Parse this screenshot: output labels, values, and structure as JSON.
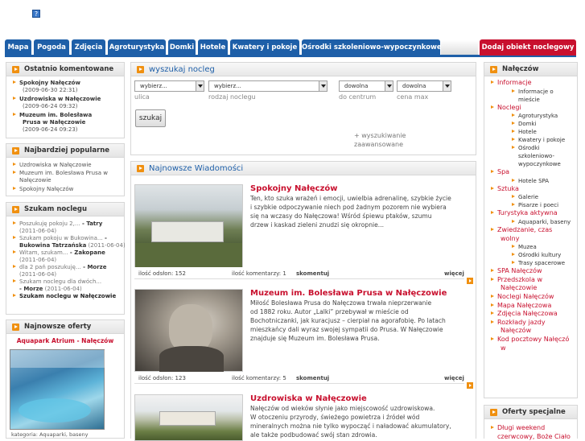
{
  "nav": {
    "tabs": [
      "Mapa",
      "Pogoda",
      "Zdjęcia",
      "Agroturystyka",
      "Domki",
      "Hotele",
      "Kwatery i pokoje",
      "Ośrodki szkoleniowo-wypoczynkowe"
    ],
    "add_button": "Dodaj obiekt noclegowy"
  },
  "left": {
    "recent": {
      "title": "Ostatnio komentowane",
      "items": [
        {
          "name": "Spokojny Nałęczów",
          "date": "(2009-06-30 22:31)"
        },
        {
          "name": "Uzdrowiska w Nałęczowie",
          "date": "(2009-06-24 09:32)"
        },
        {
          "name": "Muzeum im. Bolesława",
          "name2": "Prusa w Nałęczowie",
          "date": "(2009-06-24 09:23)"
        }
      ]
    },
    "popular": {
      "title": "Najbardziej popularne",
      "items": [
        "Uzdrowiska w Nałęczowie",
        "Muzeum im. Bolesława Prusa w",
        "Nałęczowie",
        "Spokojny Nałęczów"
      ]
    },
    "search": {
      "title": "Szukam noclegu",
      "lines": [
        {
          "a": "Poszukuję pokoju 2,...",
          "b": " - Tatry"
        },
        {
          "a": "(2011-06-04)",
          "b": ""
        },
        {
          "a": "Szukam pokoju w Bukowina...",
          "b": " -"
        },
        {
          "a": "Bukowina Tatrzańska",
          "b": " (2011-06-04)"
        },
        {
          "a": "Witam, szukam...",
          "b": " - Zakopane"
        },
        {
          "a": "(2011-06-04)",
          "b": ""
        },
        {
          "a": "dla 2 pań poszukuję...",
          "b": " - Morze"
        },
        {
          "a": "(2011-06-04)",
          "b": ""
        },
        {
          "a": "Szukam noclegu dla dwóch...",
          "b": ""
        },
        {
          "a": "- Morze",
          "b": " (2011-06-04)"
        }
      ],
      "footer": "Szukam noclegu w Nałęczowie"
    },
    "offers": {
      "title": "Najnowsze oferty",
      "offer_title": "Aquapark Atrium - Nałęczów",
      "category": "kategoria: Aquaparki, baseny"
    }
  },
  "search_panel": {
    "title": "wyszukaj nocleg",
    "selects": [
      {
        "value": "wybierz...",
        "label": "ulica"
      },
      {
        "value": "wybierz...",
        "label": "rodzaj noclegu"
      },
      {
        "value": "dowolna",
        "label": "do centrum"
      },
      {
        "value": "dowolna",
        "label": "cena max"
      }
    ],
    "button": "szukaj",
    "advanced": "+ wyszukiwanie zaawansowane"
  },
  "news": {
    "title": "Najnowsze Wiadomości",
    "items": [
      {
        "title": "Spokojny Nałęczów",
        "lines": [
          "Ten, kto szuka wrażeń i emocji, uwielbia adrenalinę, szybkie życie",
          "i szybkie odpoczywanie niech pod żadnym pozorem nie wybiera",
          "się na wczasy do Nałęczowa! Wśród śpiewu ptaków, szumu",
          "drzew i kaskad zieleni znudzi się okropnie..."
        ],
        "views": "ilość odsłon: 152",
        "comments": "ilość komentarzy: 1",
        "comments_link": "skomentuj",
        "more": "więcej"
      },
      {
        "title": "Muzeum im. Bolesława Prusa w Nałęczowie",
        "lines": [
          "Miłość Bolesława Prusa do Nałęczowa trwała nieprzerwanie",
          "od 1882 roku. Autor „Lalki” przebywał w mieście od",
          "Bochotniczanki, jak kuracjusz – cierpiał na agorafobię. Po latach",
          "mieszkańcy dali wyraz swojej sympatii do Prusa. W Nałęczowie",
          "znajduje się Muzeum im. Bolesława Prusa."
        ],
        "views": "ilość odsłon: 123",
        "comments": "ilość komentarzy: 5",
        "comments_link": "skomentuj",
        "more": "więcej"
      },
      {
        "title": "Uzdrowiska w Nałęczowie",
        "lines": [
          "Nałęczów od wieków słynie jako miejscowość uzdrowiskowa.",
          "W otoczeniu przyrody, świeżego powietrza i źródeł wód",
          "mineralnych można nie tylko wypocząć i naładować akumulatory,",
          "ale także podbudować swój stan zdrowia."
        ]
      }
    ]
  },
  "right": {
    "title": "Nałęczów",
    "items": [
      {
        "t": "Informacje",
        "k": "main"
      },
      {
        "t": "Informacje o",
        "k": "sub"
      },
      {
        "t": "mieście",
        "k": "cont"
      },
      {
        "t": "Noclegi",
        "k": "main"
      },
      {
        "t": "Agroturystyka",
        "k": "sub"
      },
      {
        "t": "Domki",
        "k": "sub"
      },
      {
        "t": "Hotele",
        "k": "sub"
      },
      {
        "t": "Kwatery i pokoje",
        "k": "sub"
      },
      {
        "t": "Ośrodki",
        "k": "sub"
      },
      {
        "t": "szkoleniowo-",
        "k": "cont"
      },
      {
        "t": "wypoczynkowe",
        "k": "cont"
      },
      {
        "t": "Spa",
        "k": "main"
      },
      {
        "t": "Hotele SPA",
        "k": "sub"
      },
      {
        "t": "Sztuka",
        "k": "main"
      },
      {
        "t": "Galerie",
        "k": "sub"
      },
      {
        "t": "Pisarze i poeci",
        "k": "sub"
      },
      {
        "t": "Turystyka aktywna",
        "k": "main"
      },
      {
        "t": "Aquaparki, baseny",
        "k": "sub"
      },
      {
        "t": "Zwiedzanie, czas",
        "k": "main"
      },
      {
        "t": "wolny",
        "k": "maincont"
      },
      {
        "t": "Muzea",
        "k": "sub"
      },
      {
        "t": "Ośrodki kultury",
        "k": "sub"
      },
      {
        "t": "Trasy spacerowe",
        "k": "sub"
      },
      {
        "t": "SPA Nałęczów",
        "k": "main"
      },
      {
        "t": "Przedszkola w",
        "k": "main"
      },
      {
        "t": "Nałęczowie",
        "k": "maincont"
      },
      {
        "t": "Noclegi Nałęczów",
        "k": "main"
      },
      {
        "t": "Mapa Nałęczowa",
        "k": "main"
      },
      {
        "t": "Zdjęcia Nałęczowa",
        "k": "main"
      },
      {
        "t": "Rozkłady jazdy",
        "k": "main"
      },
      {
        "t": "Nałęczów",
        "k": "maincont"
      },
      {
        "t": "Kod pocztowy Nałęczó",
        "k": "main"
      },
      {
        "t": "w",
        "k": "maincont"
      }
    ],
    "special": {
      "title": "Oferty specjalne",
      "line1": "Długi weekend",
      "line2": "czerwcowy, Boże Ciało"
    }
  }
}
